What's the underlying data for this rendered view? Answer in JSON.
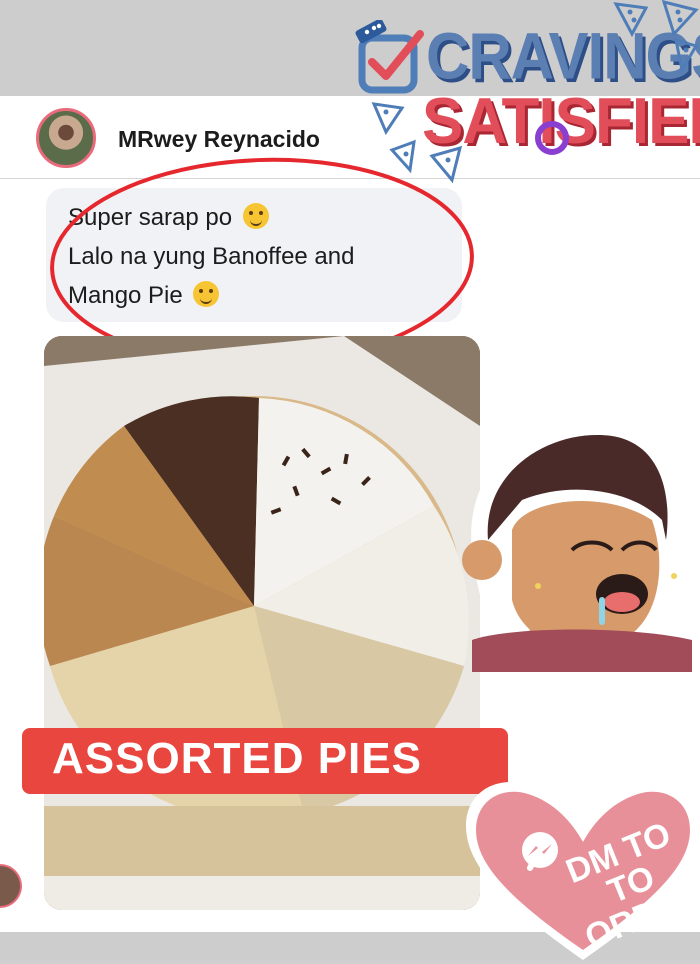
{
  "brand": {
    "title_line1": "CRAVINGS",
    "title_line2": "SATISFIED",
    "colors": {
      "blue": "#5b7fb3",
      "red": "#e24d5a"
    }
  },
  "post": {
    "username": "MRwey Reynacido",
    "comment": "Super sarap po  \nLalo na yung Banoffee and\nMango Pie",
    "comment_line1": "Super sarap po",
    "comment_line2": "Lalo na yung Banoffee and",
    "comment_line3": "Mango Pie",
    "avatar_icon": "avatar-photo",
    "emoji_1": "smiling-face-with-hearts",
    "emoji_2": "face-savoring-food"
  },
  "photo": {
    "banner_label": "ASSORTED PIES"
  },
  "cta": {
    "label_line1": "DM TO TO",
    "label_line2": "ORDER",
    "icon": "messenger-icon",
    "color": "#e8909a"
  }
}
